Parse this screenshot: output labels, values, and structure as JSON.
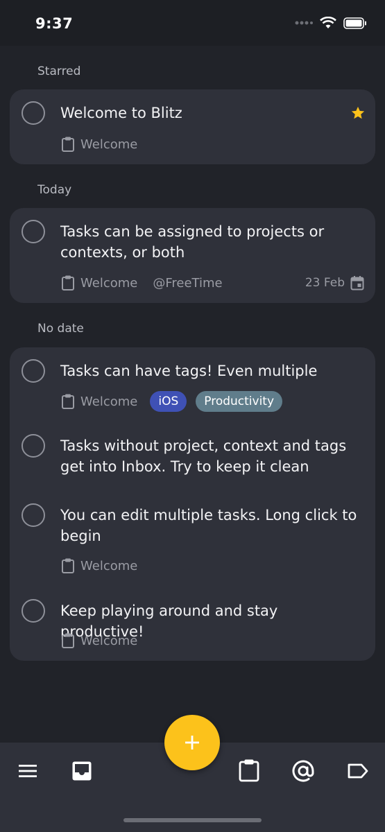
{
  "status_bar": {
    "time": "9:37"
  },
  "sections": {
    "starred": "Starred",
    "today": "Today",
    "no_date": "No date"
  },
  "tasks": {
    "t1": {
      "title": "Welcome to Blitz",
      "project": "Welcome",
      "starred": true
    },
    "t2": {
      "title": "Tasks can be assigned to projects or contexts, or both",
      "project": "Welcome",
      "context": "@FreeTime",
      "date": "23 Feb"
    },
    "t3": {
      "title": "Tasks can have tags! Even multiple",
      "project": "Welcome",
      "tags": [
        "iOS",
        "Productivity"
      ]
    },
    "t4": {
      "title": "Tasks without project, context and tags get into Inbox. Try to keep it clean"
    },
    "t5": {
      "title": "You can edit multiple tasks. Long click to begin",
      "project": "Welcome"
    },
    "t6": {
      "title": "Keep playing around and stay productive!",
      "project": "Welcome"
    }
  },
  "icons": {
    "menu": "menu-icon",
    "inbox": "inbox-icon",
    "projects": "clipboard-icon",
    "contexts": "at-icon",
    "tags": "tag-icon",
    "add": "plus-icon"
  },
  "colors": {
    "background": "#212329",
    "card": "#2f313a",
    "accent": "#fcc21b",
    "tag_ios": "#3f51b5",
    "tag_productivity": "#607d8b"
  }
}
